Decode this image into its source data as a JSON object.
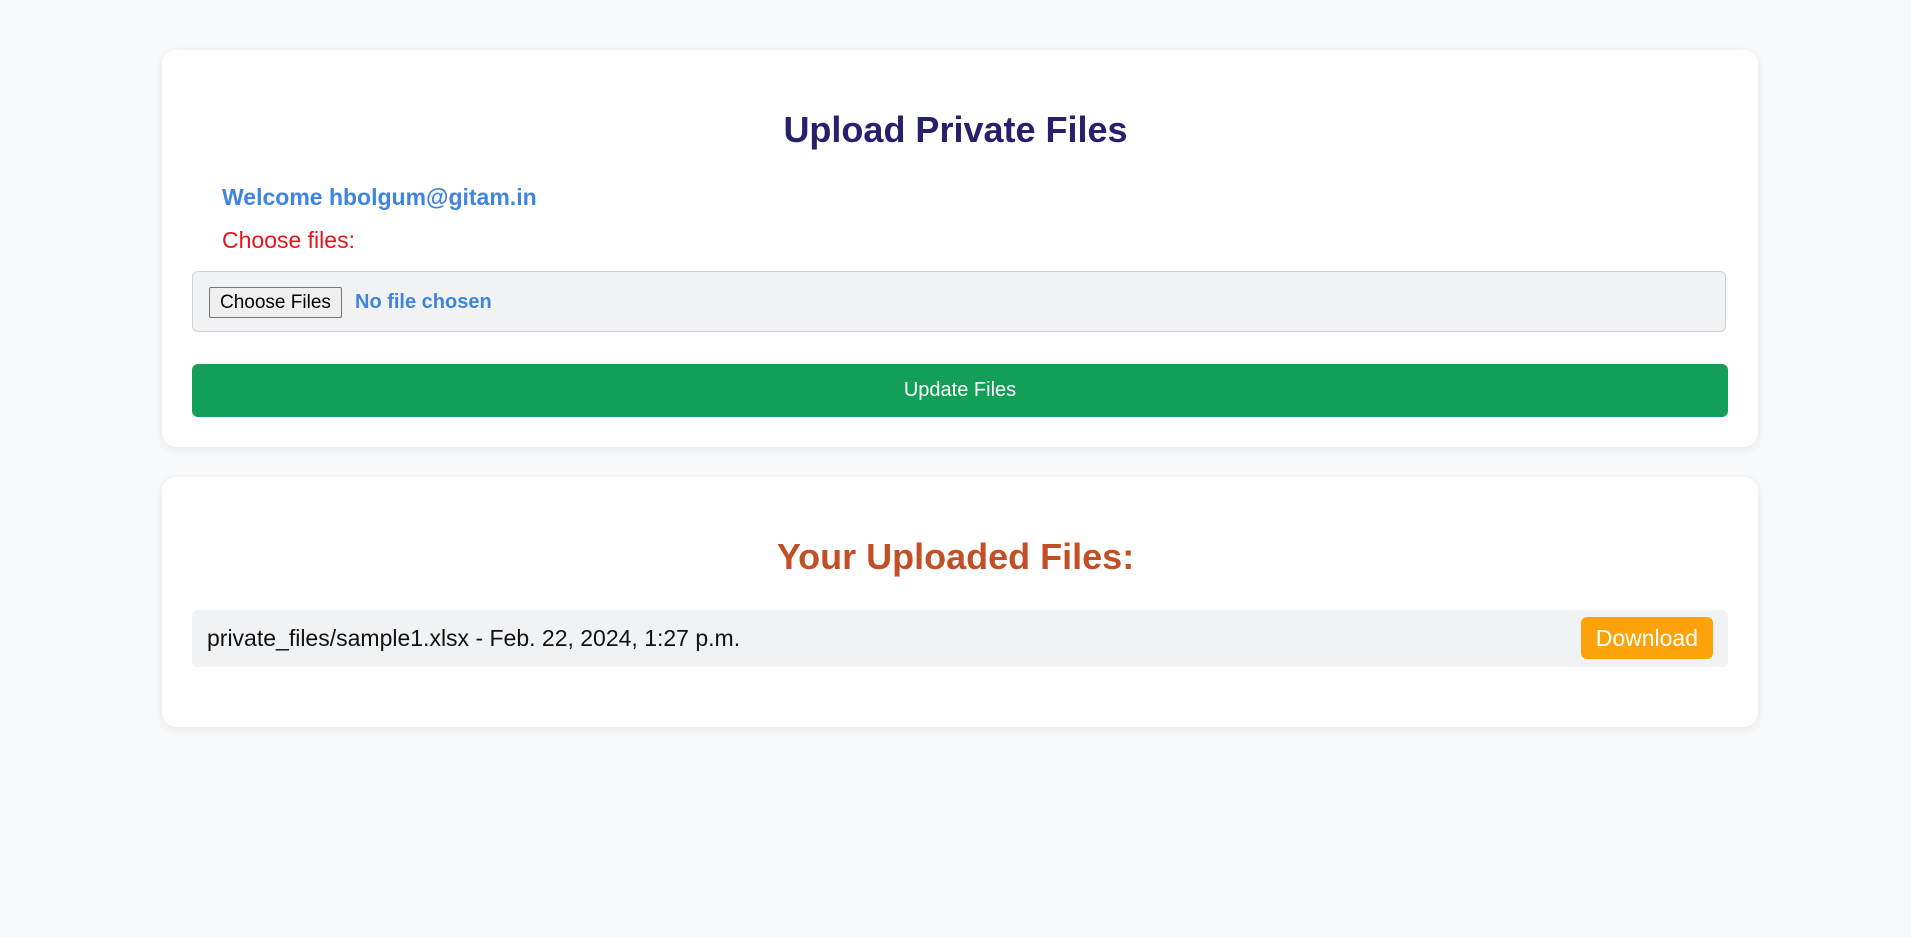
{
  "upload_section": {
    "title": "Upload Private Files",
    "welcome_text": "Welcome hbolgum@gitam.in",
    "choose_label": "Choose files:",
    "file_input": {
      "button_label": "Choose Files",
      "status_text": "No file chosen"
    },
    "submit_label": "Update Files"
  },
  "files_section": {
    "title": "Your Uploaded Files:",
    "files": [
      {
        "description": "private_files/sample1.xlsx - Feb. 22, 2024, 1:27 p.m.",
        "action_label": "Download"
      }
    ]
  },
  "colors": {
    "page_background": "#f7f8fa",
    "upload_title": "#26206d",
    "files_title": "#c34f27",
    "welcome": "#3f84de",
    "choose_label": "#e8121d",
    "submit_button": "#139f57",
    "download_button": "#fea20c"
  }
}
